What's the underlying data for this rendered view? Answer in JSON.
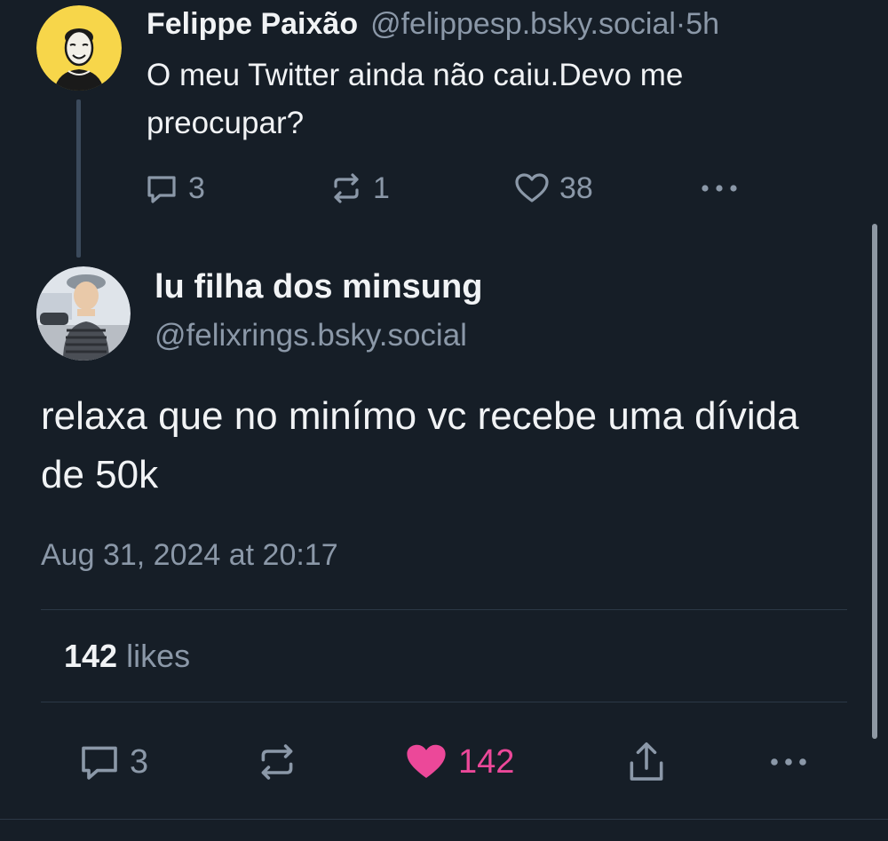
{
  "parent_post": {
    "display_name": "Felippe Paixão",
    "handle": "@felippesp.bsky.social",
    "separator": "·",
    "time": "5h",
    "text": "O meu Twitter ainda não caiu.Devo me preocupar?",
    "reply_count": "3",
    "repost_count": "1",
    "like_count": "38"
  },
  "main_post": {
    "display_name": "lu filha dos minsung",
    "handle": "@felixrings.bsky.social",
    "text": "relaxa que no minímo vc recebe uma dívida de 50k",
    "timestamp": "Aug 31, 2024 at 20:17",
    "likes_summary": {
      "count": "142",
      "label": "likes"
    },
    "reply_count": "3",
    "like_count": "142",
    "liked": true
  },
  "colors": {
    "background": "#161e27",
    "muted_text": "#8b98a8",
    "primary_text": "#f1f3f5",
    "like_pink": "#ec4899",
    "parent_avatar_bg": "#f7d64a"
  },
  "icons": [
    "reply-icon",
    "repost-icon",
    "heart-icon",
    "share-icon",
    "more-icon"
  ]
}
